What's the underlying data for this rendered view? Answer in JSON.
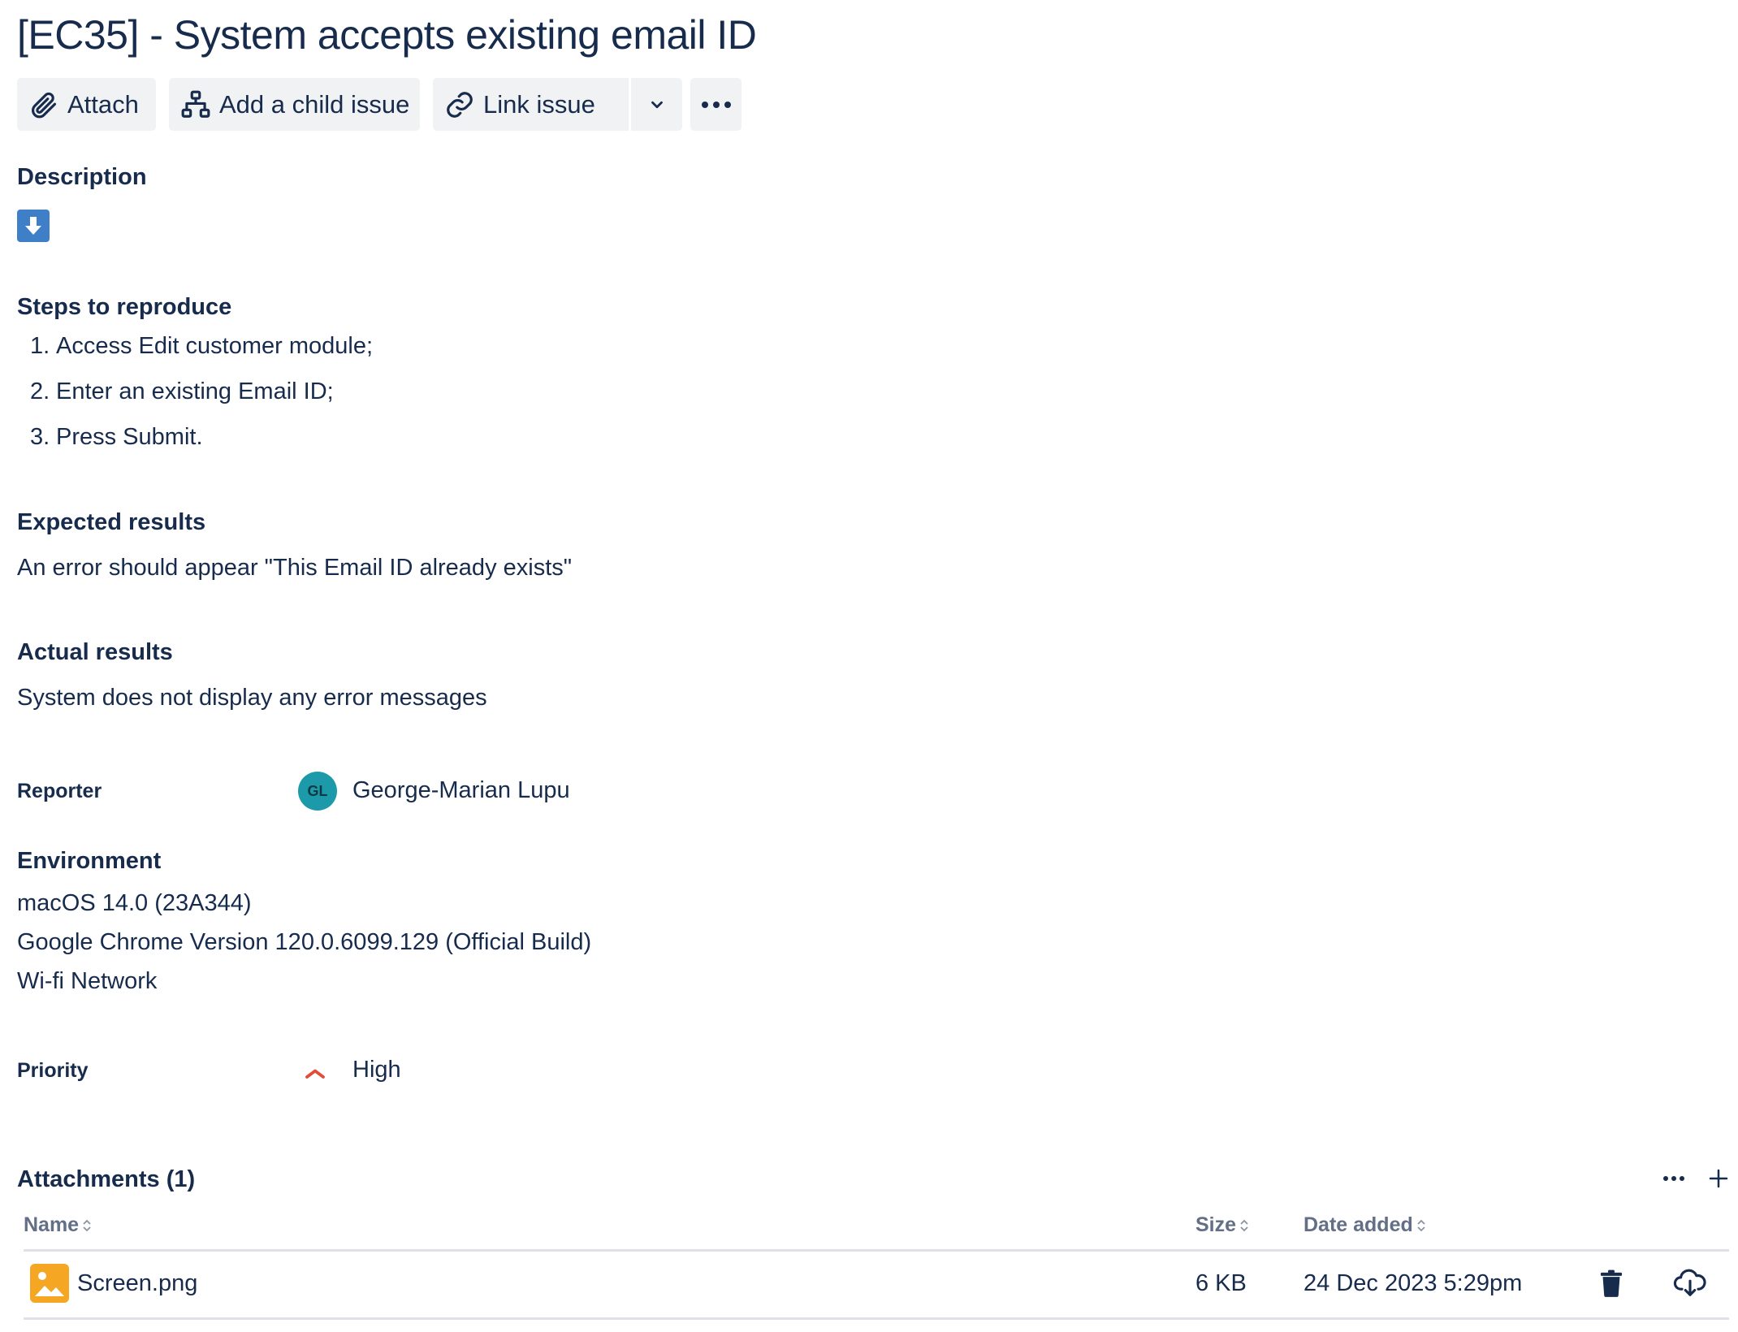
{
  "issue": {
    "title": "[EC35] - System accepts existing email ID"
  },
  "toolbar": {
    "attach_label": "Attach",
    "child_label": "Add a child issue",
    "link_label": "Link issue"
  },
  "description": {
    "heading": "Description",
    "steps_heading": "Steps to reproduce",
    "steps": [
      {
        "num": "1.",
        "text": "Access Edit customer module;"
      },
      {
        "num": "2.",
        "text": "Enter an existing Email ID;"
      },
      {
        "num": "3.",
        "text": "Press Submit."
      }
    ],
    "expected_heading": "Expected results",
    "expected_text": "An error should appear \"This Email ID already exists\"",
    "actual_heading": "Actual results",
    "actual_text": "System does not display any error messages"
  },
  "reporter": {
    "label": "Reporter",
    "initials": "GL",
    "name": "George-Marian Lupu",
    "avatar_color": "#1d9aaa"
  },
  "environment": {
    "heading": "Environment",
    "lines": [
      "macOS 14.0 (23A344)",
      "Google Chrome Version 120.0.6099.129 (Official Build)",
      "Wi-fi Network"
    ]
  },
  "priority": {
    "label": "Priority",
    "value": "High",
    "color": "#e5493a"
  },
  "attachments": {
    "heading": "Attachments (1)",
    "columns": {
      "name": "Name",
      "size": "Size",
      "date": "Date added"
    },
    "rows": [
      {
        "name": "Screen.png",
        "size": "6 KB",
        "date": "24 Dec 2023 5:29pm",
        "icon": "image-file-icon"
      }
    ]
  },
  "colors": {
    "text": "#172b4d",
    "button_bg": "#f1f2f4",
    "description_icon": "#3f7fc8",
    "file_icon": "#f5a623"
  }
}
